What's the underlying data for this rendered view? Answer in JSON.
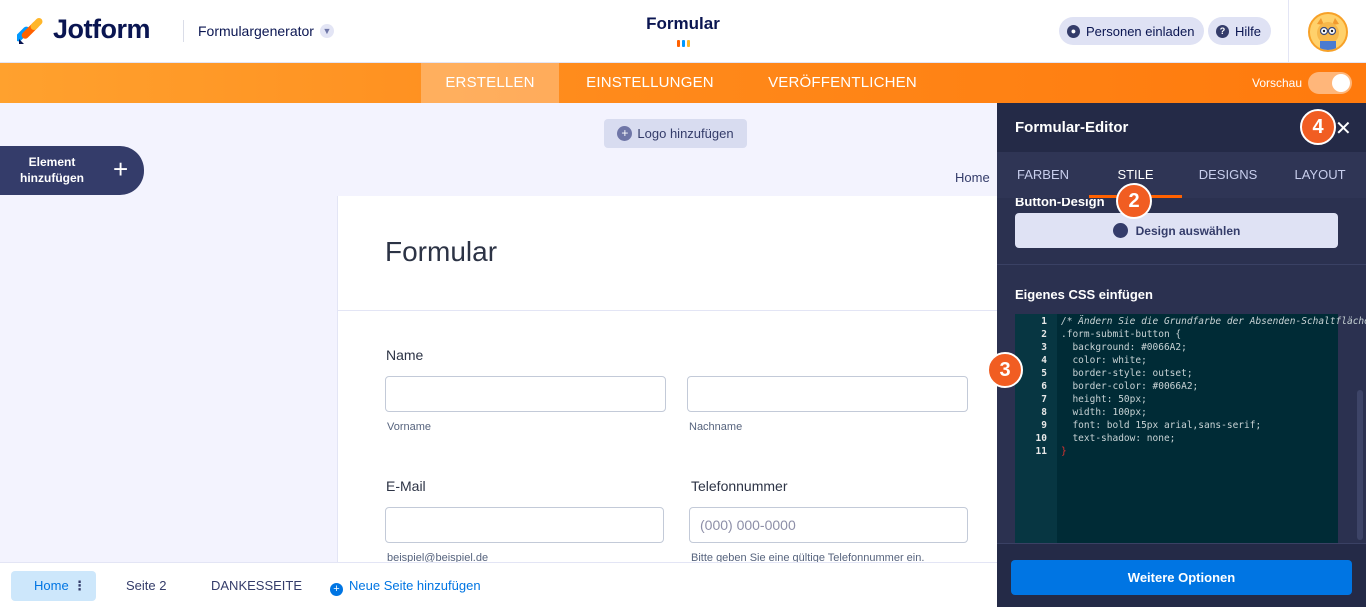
{
  "header": {
    "brand": "Jotform",
    "generator": "Formulargenerator",
    "title": "Formular",
    "invite": "Personen einladen",
    "help": "Hilfe"
  },
  "nav": {
    "tabs": [
      "ERSTELLEN",
      "EINSTELLUNGEN",
      "VERÖFFENTLICHEN"
    ],
    "active": "ERSTELLEN",
    "preview": "Vorschau",
    "preview_on": false
  },
  "builder": {
    "add_element": "Element hinzufügen",
    "add_logo": "Logo hinzufügen",
    "breadcrumb": "Home"
  },
  "form": {
    "title": "Formular",
    "name_label": "Name",
    "first_sub": "Vorname",
    "last_sub": "Nachname",
    "email_label": "E-Mail",
    "email_sub": "beispiel@beispiel.de",
    "phone_label": "Telefonnummer",
    "phone_placeholder": "(000) 000-0000",
    "phone_sub": "Bitte geben Sie eine gültige Telefonnummer ein."
  },
  "pages": {
    "items": [
      "Home",
      "Seite 2",
      "DANKESSEITE"
    ],
    "add": "Neue Seite hinzufügen"
  },
  "panel": {
    "title": "Formular-Editor",
    "tabs": [
      "FARBEN",
      "STILE",
      "DESIGNS",
      "LAYOUT"
    ],
    "active_tab": "STILE",
    "partial_label": "Button-Design",
    "design_button": "Design auswählen",
    "css_label": "Eigenes CSS einfügen",
    "more_options": "Weitere Optionen"
  },
  "code_lines": [
    "/* Ändern Sie die Grundfarbe der Absenden-Schaltfläche */",
    ".form-submit-button {",
    "  background: #0066A2;",
    "  color: white;",
    "  border-style: outset;",
    "  border-color: #0066A2;",
    "  height: 50px;",
    "  width: 100px;",
    "  font: bold 15px arial,sans-serif;",
    "  text-shadow: none;",
    "}"
  ],
  "badges": [
    "2",
    "3",
    "4"
  ],
  "colors": {
    "accent": "#ff6100",
    "primary": "#0075e3",
    "badge": "#f15d22",
    "navy": "#0a1551"
  }
}
